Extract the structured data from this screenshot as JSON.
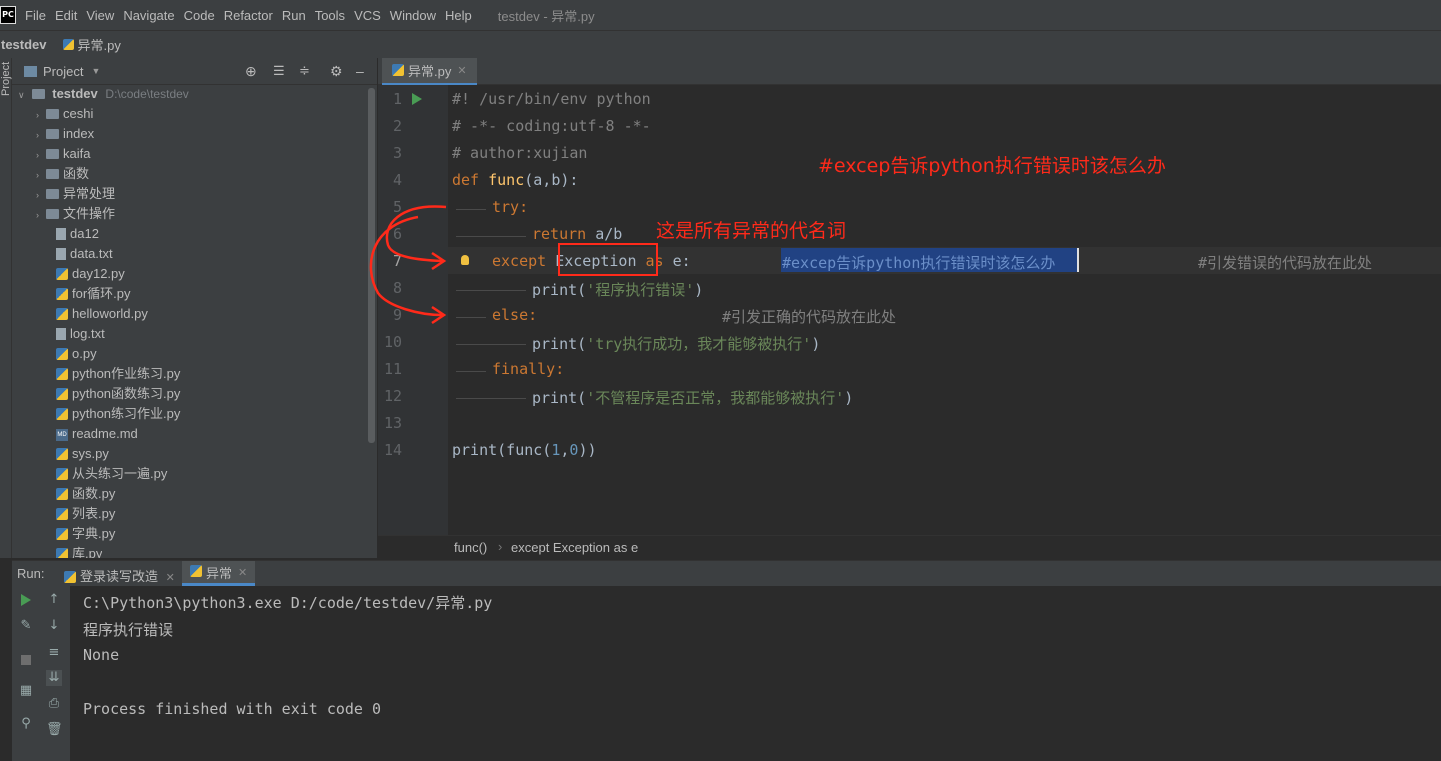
{
  "menubar": {
    "app_icon": "PC",
    "items": [
      "File",
      "Edit",
      "View",
      "Navigate",
      "Code",
      "Refactor",
      "Run",
      "Tools",
      "VCS",
      "Window",
      "Help"
    ],
    "title": "testdev - 异常.py"
  },
  "navbar": {
    "project": "testdev",
    "file": "异常.py"
  },
  "stripe": {
    "label": "Project"
  },
  "project_panel": {
    "title": "Project",
    "root": {
      "name": "testdev",
      "path": "D:\\code\\testdev"
    },
    "folders": [
      "ceshi",
      "index",
      "kaifa",
      "函数",
      "异常处理",
      "文件操作"
    ],
    "files": [
      "da12",
      "data.txt",
      "day12.py",
      "for循环.py",
      "helloworld.py",
      "log.txt",
      "o.py",
      "python作业练习.py",
      "python函数练习.py",
      "python练习作业.py",
      "readme.md",
      "sys.py",
      "从头练习一遍.py",
      "函数.py",
      "列表.py",
      "字典.py",
      "库.py"
    ]
  },
  "editor": {
    "tab": "异常.py",
    "line_numbers": [
      "1",
      "2",
      "3",
      "4",
      "5",
      "6",
      "7",
      "8",
      "9",
      "10",
      "11",
      "12",
      "13",
      "14"
    ],
    "lines": {
      "l1": "#! /usr/bin/env python",
      "l2": "# -*- coding:utf-8 -*-",
      "l3": "# author:xujian",
      "l4_def": "def",
      "l4_name": "func",
      "l4_rest": "(a,b):",
      "l5": "try:",
      "l6_kw": "return",
      "l6_rest": " a/b",
      "l7_kw": "except",
      "l7_exc": "Exception",
      "l7_as": "as",
      "l7_e": "e:",
      "l7_comment": "#excep告诉python执行错误时该怎么办",
      "l7_comment2": "#引发错误的代码放在此处",
      "l8_fn": "print(",
      "l8_str": "'程序执行错误'",
      "l8_end": ")",
      "l9_kw": "else:",
      "l9_comment": "#引发正确的代码放在此处",
      "l10_fn": "print(",
      "l10_str": "'try执行成功，我才能够被执行'",
      "l10_end": ")",
      "l11_kw": "finally:",
      "l12_fn": "print(",
      "l12_str": "'不管程序是否正常，我都能够被执行'",
      "l12_end": ")",
      "l14_a": "print(func(",
      "l14_n1": "1",
      "l14_c": ",",
      "l14_n2": "0",
      "l14_b": "))"
    },
    "breadcrumbs": [
      "func()",
      "except Exception as e"
    ]
  },
  "run_panel": {
    "label": "Run:",
    "tabs": [
      "登录读写改造",
      "异常"
    ],
    "output": [
      "C:\\Python3\\python3.exe D:/code/testdev/异常.py",
      "程序执行错误",
      "None",
      "",
      "Process finished with exit code 0"
    ]
  },
  "annotations": {
    "top": "#excep告诉python执行错误时该怎么办",
    "alias": "这是所有异常的代名词"
  },
  "colors": {
    "annotation": "#ff2a1a",
    "keyword": "#cc7832",
    "string": "#6a8759",
    "comment": "#808080",
    "selection": "#214283"
  }
}
